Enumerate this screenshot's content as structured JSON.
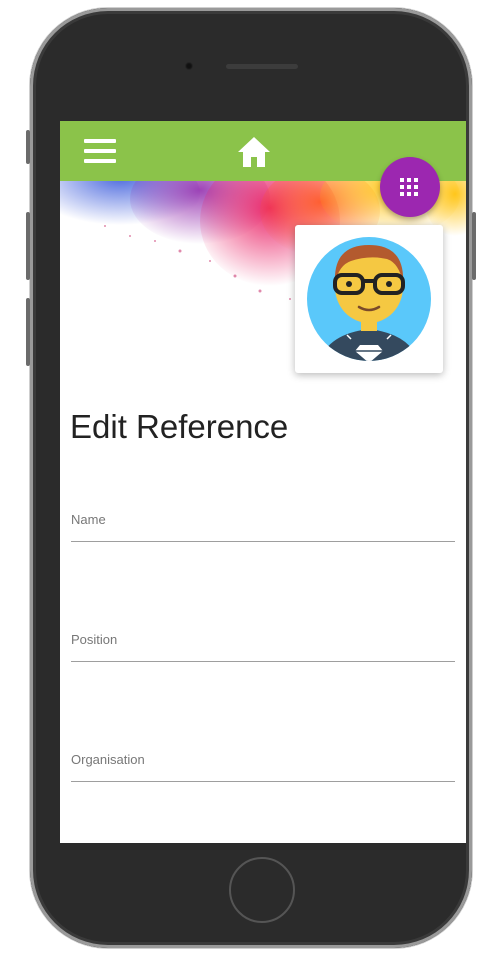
{
  "form": {
    "title": "Edit Reference",
    "fields": [
      {
        "label": "Name",
        "value": ""
      },
      {
        "label": "Position",
        "value": ""
      },
      {
        "label": "Organisation",
        "value": ""
      }
    ]
  },
  "toolbar": {
    "menu_icon": "hamburger-menu-icon",
    "home_icon": "home-icon",
    "apps_icon": "grid-icon"
  },
  "colors": {
    "toolbar": "#8bc34a",
    "fab": "#9c27b0",
    "avatar_bg": "#5ac8fa"
  }
}
